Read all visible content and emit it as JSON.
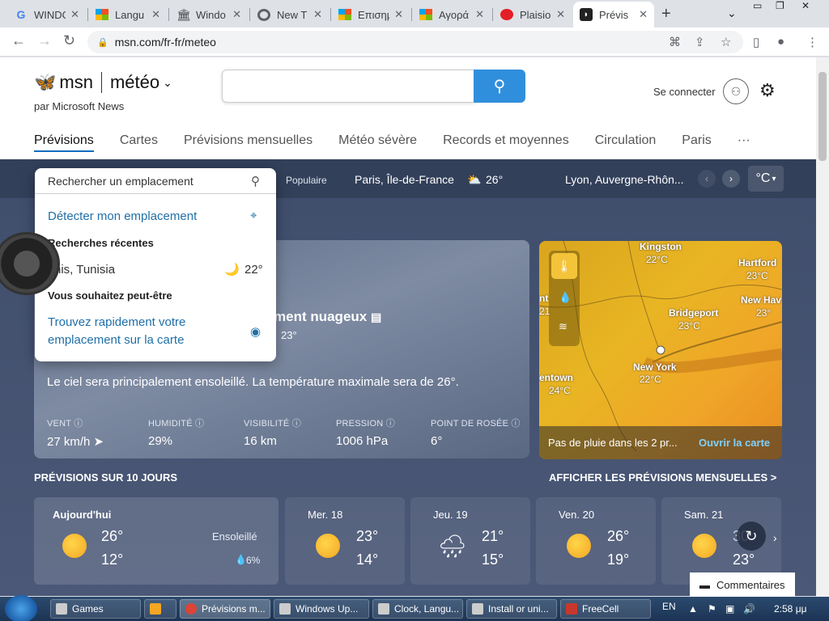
{
  "browser": {
    "tabs": [
      {
        "title": "WINDO",
        "icon": "google-icon"
      },
      {
        "title": "Langu",
        "icon": "microsoft-icon"
      },
      {
        "title": "Windo",
        "icon": "museum-icon"
      },
      {
        "title": "New T",
        "icon": "chrome-icon"
      },
      {
        "title": "Επισημ",
        "icon": "microsoft-icon"
      },
      {
        "title": "Αγορά",
        "icon": "microsoft-icon"
      },
      {
        "title": "Plaisio",
        "icon": "red-dot-icon"
      },
      {
        "title": "Prévis",
        "icon": "msn-icon"
      }
    ],
    "url": "msn.com/fr-fr/meteo"
  },
  "header": {
    "brand": "msn",
    "section": "météo",
    "byline": "par Microsoft News",
    "signin": "Se connecter",
    "nav": [
      "Prévisions",
      "Cartes",
      "Prévisions mensuelles",
      "Météo sévère",
      "Records et moyennes",
      "Circulation",
      "Paris",
      "···"
    ]
  },
  "locbar": {
    "popular": "Populaire",
    "loc1": "Paris, Île-de-France",
    "loc1_temp": "26°",
    "loc2": "Lyon, Auvergne-Rhôn...",
    "unit": "°C"
  },
  "dropdown": {
    "placeholder": "Rechercher un emplacement",
    "detect": "Détecter mon emplacement",
    "recent_head": "Recherches récentes",
    "recent_item": "nis, Tunisia",
    "recent_temp": "22°",
    "suggest_head": "Vous souhaitez peut-être",
    "suggest_item_1": "Trouvez rapidement votre",
    "suggest_item_2": "emplacement sur la carte"
  },
  "current": {
    "condition": "ment nuageux",
    "feels": "23°",
    "summary": "Le ciel sera principalement ensoleillé. La température maximale sera de 26°.",
    "stats": [
      {
        "label": "VENT",
        "value": "27 km/h ➤"
      },
      {
        "label": "HUMIDITÉ",
        "value": "29%"
      },
      {
        "label": "VISIBILITÉ",
        "value": "16 km"
      },
      {
        "label": "PRESSION",
        "value": "1006 hPa"
      },
      {
        "label": "POINT DE ROSÉE",
        "value": "6°"
      }
    ]
  },
  "map": {
    "cities": [
      {
        "name": "Kingston",
        "temp": "22°C"
      },
      {
        "name": "Hartford",
        "temp": "23°C"
      },
      {
        "name": "New Hav",
        "temp": "23°"
      },
      {
        "name": "Bridgeport",
        "temp": "23°C"
      },
      {
        "name": "New York",
        "temp": "22°C"
      },
      {
        "name": "entown",
        "temp": "24°C"
      },
      {
        "name": "nt",
        "temp": "21"
      }
    ],
    "caption": "Pas de pluie dans les 2 pr...",
    "open": "Ouvrir la carte"
  },
  "forecast": {
    "heading": "PRÉVISIONS SUR 10 JOURS",
    "monthly": "AFFICHER LES PRÉVISIONS MENSUELLES >",
    "days": [
      {
        "name": "Aujourd'hui",
        "hi": "26°",
        "lo": "12°",
        "desc": "Ensoleillé",
        "rain": "6%"
      },
      {
        "name": "Mer. 18",
        "hi": "23°",
        "lo": "14°"
      },
      {
        "name": "Jeu. 19",
        "hi": "21°",
        "lo": "15°"
      },
      {
        "name": "Ven. 20",
        "hi": "26°",
        "lo": "19°"
      },
      {
        "name": "Sam. 21",
        "hi": "30",
        "lo": "23°"
      }
    ]
  },
  "feedback": "Commentaires",
  "taskbar": {
    "items": [
      "Games",
      "",
      "Prévisions m...",
      "Windows Up...",
      "Clock, Langu...",
      "Install or uni...",
      "FreeCell"
    ],
    "lang": "EN",
    "time": "2:58 μμ"
  }
}
